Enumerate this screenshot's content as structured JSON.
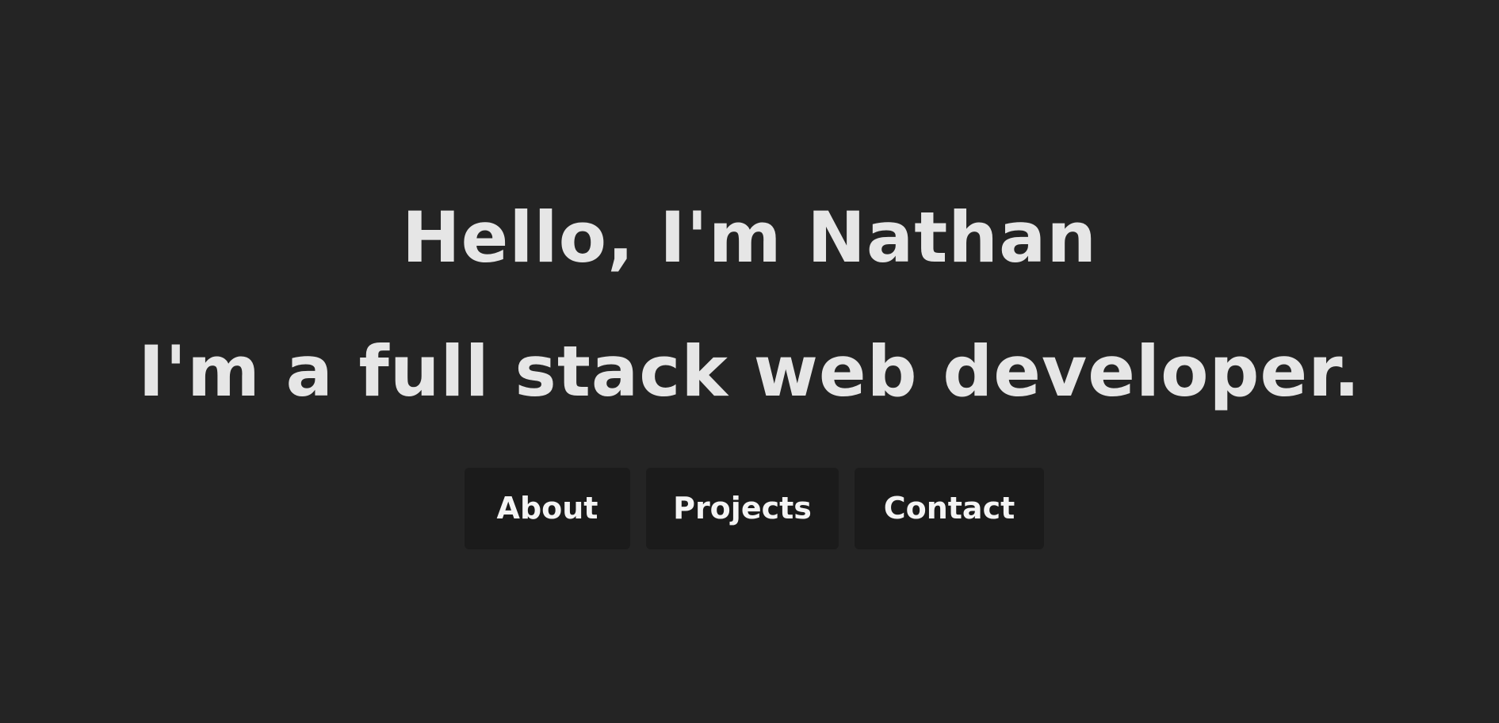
{
  "hero": {
    "greeting": "Hello, I'm Nathan",
    "tagline": "I'm a full stack web developer."
  },
  "nav": {
    "items": [
      {
        "label": "About"
      },
      {
        "label": "Projects"
      },
      {
        "label": "Contact"
      }
    ]
  },
  "colors": {
    "background": "#242424",
    "text": "#e6e6e6",
    "button_background": "#1b1b1b",
    "button_text": "#f4f4f4"
  }
}
